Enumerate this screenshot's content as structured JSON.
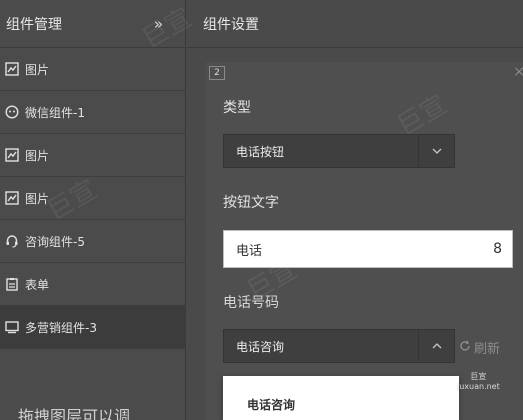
{
  "sidebar": {
    "title": "组件管理",
    "collapse_icon": "»",
    "items": [
      {
        "label": "图片",
        "icon": "image-icon"
      },
      {
        "label": "微信组件-1",
        "icon": "wechat-icon"
      },
      {
        "label": "图片",
        "icon": "image-icon"
      },
      {
        "label": "图片",
        "icon": "image-icon"
      },
      {
        "label": "咨询组件-5",
        "icon": "headset-icon"
      },
      {
        "label": "表单",
        "icon": "form-icon"
      },
      {
        "label": "多营销组件-3",
        "icon": "monitor-icon"
      }
    ],
    "hint": "拖拽图层可以调"
  },
  "main": {
    "title": "组件设置",
    "panel": {
      "index": "2",
      "close": "×",
      "type_label": "类型",
      "type_value": "电话按钮",
      "button_text_label": "按钮文字",
      "button_text_value": "电话",
      "button_text_count": "8",
      "phone_label": "电话号码",
      "phone_select_value": "电话咨询",
      "refresh_label": "刷新",
      "dropdown_option": "电话咨询"
    }
  },
  "brand": {
    "line1": "巨宣",
    "line2": "juxuan.net"
  }
}
